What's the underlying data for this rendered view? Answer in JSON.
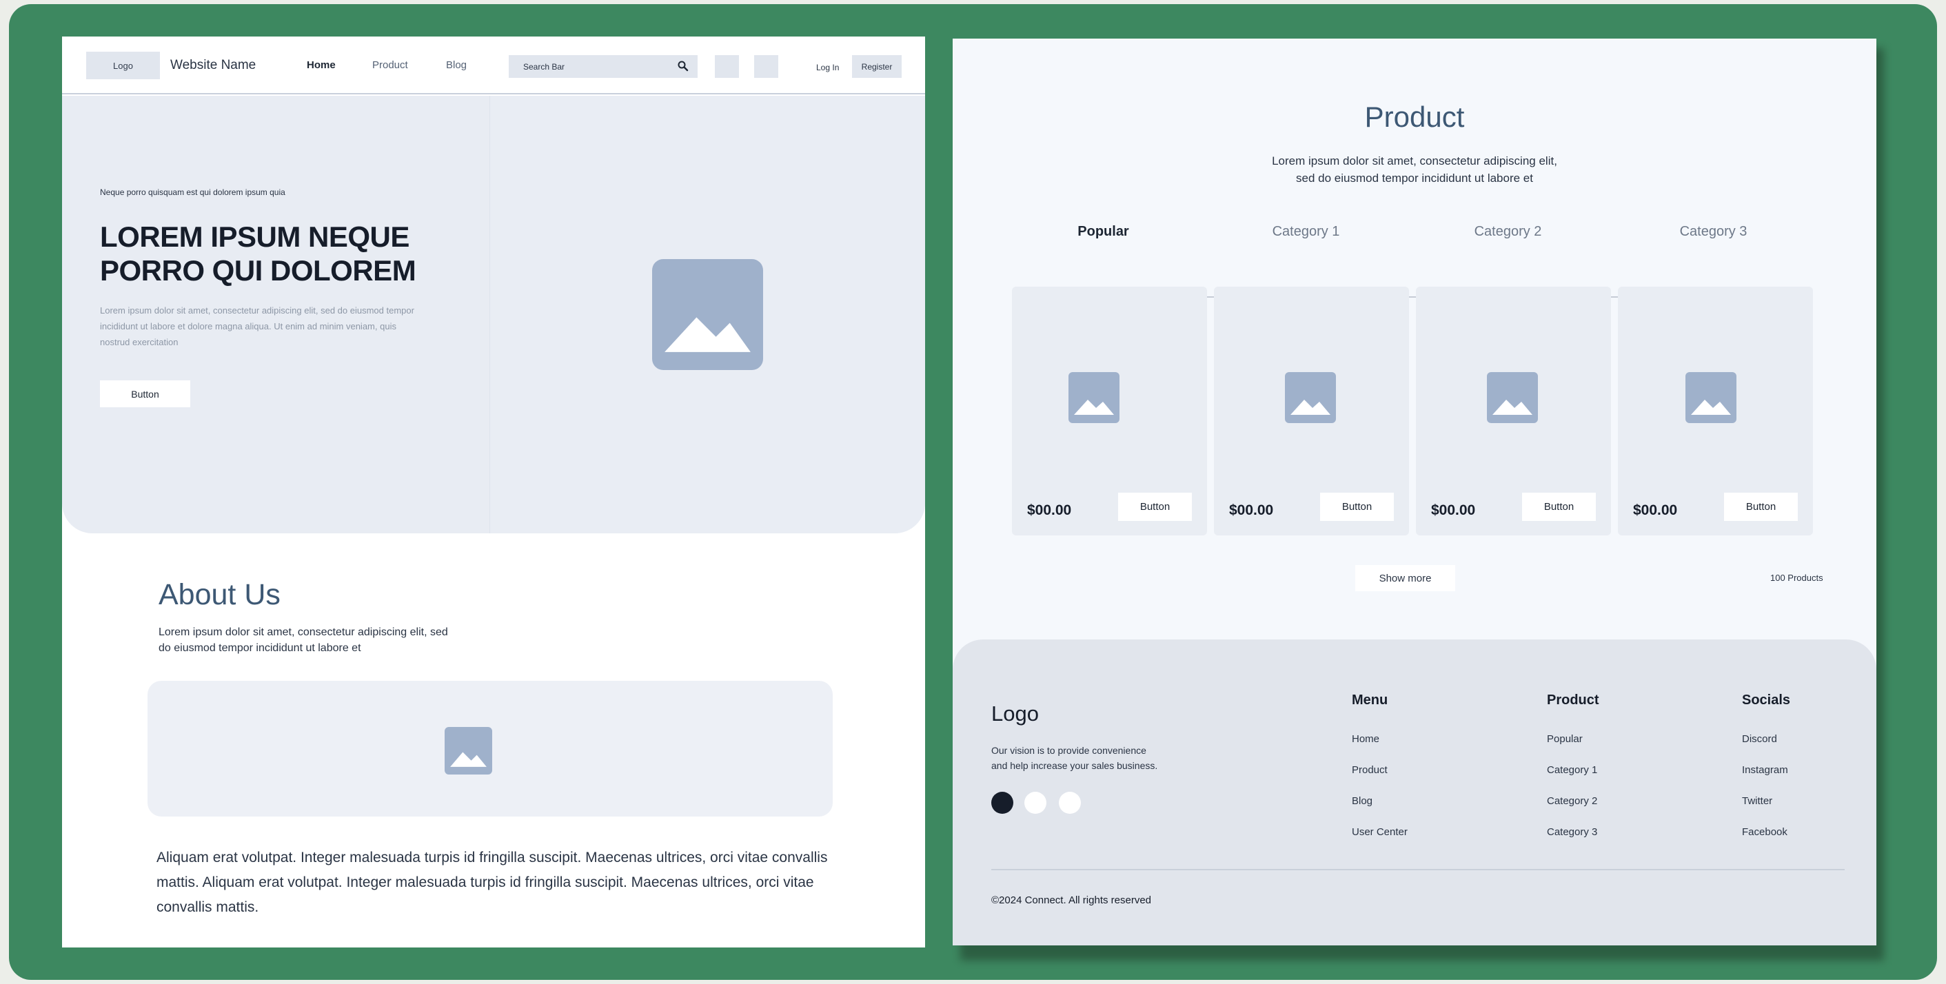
{
  "left": {
    "nav": {
      "logo": "Logo",
      "site_name": "Website Name",
      "links": [
        "Home",
        "Product",
        "Blog"
      ],
      "search_placeholder": "Search Bar",
      "login": "Log In",
      "register": "Register"
    },
    "hero": {
      "eyebrow": "Neque porro quisquam est qui dolorem ipsum quia",
      "title_line1": "LOREM IPSUM NEQUE",
      "title_line2": "PORRO QUI DOLOREM",
      "text": "Lorem ipsum dolor sit amet, consectetur adipiscing elit, sed do eiusmod tempor incididunt ut labore et dolore magna aliqua. Ut enim ad minim veniam, quis nostrud exercitation",
      "button": "Button"
    },
    "about": {
      "title": "About Us",
      "subtitle_line1": "Lorem ipsum dolor sit amet, consectetur adipiscing elit, sed",
      "subtitle_line2": "do eiusmod tempor incididunt ut labore et",
      "paragraph": "Aliquam erat volutpat. Integer malesuada turpis id fringilla suscipit. Maecenas ultrices, orci vitae convallis mattis. Aliquam erat volutpat. Integer malesuada turpis id fringilla suscipit. Maecenas ultrices, orci vitae convallis mattis."
    }
  },
  "right": {
    "title": "Product",
    "subtitle_line1": "Lorem ipsum dolor sit amet, consectetur adipiscing elit,",
    "subtitle_line2": "sed do eiusmod tempor incididunt ut labore et",
    "tabs": [
      "Popular",
      "Category 1",
      "Category 2",
      "Category 3"
    ],
    "products": [
      {
        "price": "$00.00",
        "button": "Button"
      },
      {
        "price": "$00.00",
        "button": "Button"
      },
      {
        "price": "$00.00",
        "button": "Button"
      },
      {
        "price": "$00.00",
        "button": "Button"
      }
    ],
    "show_more": "Show more",
    "product_count": "100 Products",
    "footer": {
      "logo": "Logo",
      "vision_line1": "Our vision is to provide convenience",
      "vision_line2": "and help increase your sales business.",
      "columns": [
        {
          "heading": "Menu",
          "links": [
            "Home",
            "Product",
            "Blog",
            "User Center"
          ]
        },
        {
          "heading": "Product",
          "links": [
            "Popular",
            "Category 1",
            "Category 2",
            "Category 3"
          ]
        },
        {
          "heading": "Socials",
          "links": [
            "Discord",
            "Instagram",
            "Twitter",
            "Facebook"
          ]
        }
      ],
      "copyright": "©2024 Connect. All rights reserved"
    }
  },
  "colors": {
    "frame": "#3d8860",
    "image_placeholder": "#9fb1cb",
    "hero_bg": "#e8ecf3",
    "footer_bg": "#e1e5ec",
    "heading_blue": "#3d5874"
  }
}
